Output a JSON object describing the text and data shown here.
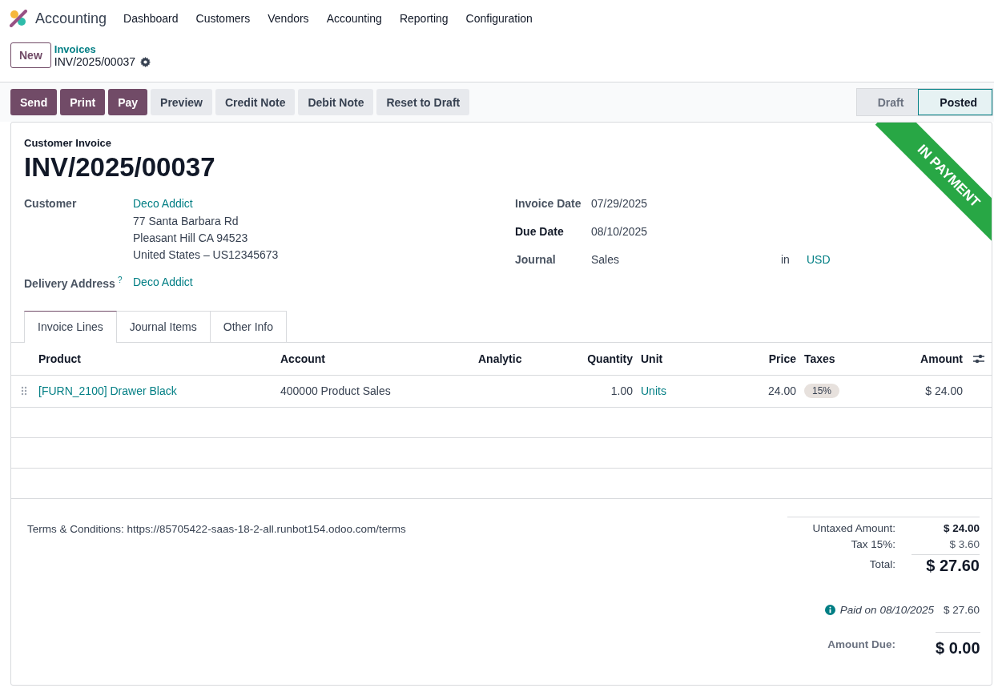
{
  "app": {
    "name": "Accounting"
  },
  "menu": [
    "Dashboard",
    "Customers",
    "Vendors",
    "Accounting",
    "Reporting",
    "Configuration"
  ],
  "new_button": "New",
  "breadcrumb": {
    "parent": "Invoices",
    "current": "INV/2025/00037"
  },
  "actions": [
    {
      "label": "Send",
      "kind": "primary"
    },
    {
      "label": "Print",
      "kind": "primary"
    },
    {
      "label": "Pay",
      "kind": "primary"
    },
    {
      "label": "Preview",
      "kind": "secondary"
    },
    {
      "label": "Credit Note",
      "kind": "secondary"
    },
    {
      "label": "Debit Note",
      "kind": "secondary"
    },
    {
      "label": "Reset to Draft",
      "kind": "secondary"
    }
  ],
  "status": [
    {
      "label": "Draft",
      "selected": false
    },
    {
      "label": "Posted",
      "selected": true
    }
  ],
  "ribbon": "IN PAYMENT",
  "document": {
    "type": "Customer Invoice",
    "number": "INV/2025/00037"
  },
  "customer": {
    "label": "Customer",
    "name": "Deco Addict",
    "address": [
      "77 Santa Barbara Rd",
      "Pleasant Hill CA 94523",
      "United States – US12345673"
    ]
  },
  "delivery": {
    "label": "Delivery Address",
    "help": "?",
    "value": "Deco Addict"
  },
  "right_fields": [
    {
      "label": "Invoice Date",
      "value": "07/29/2025",
      "required": false
    },
    {
      "label": "Due Date",
      "value": "08/10/2025",
      "required": true
    },
    {
      "label": "Journal",
      "value": "Sales",
      "required": false,
      "currency_prefix": "in",
      "currency": "USD"
    }
  ],
  "tabs": [
    {
      "label": "Invoice Lines",
      "selected": true
    },
    {
      "label": "Journal Items",
      "selected": false
    },
    {
      "label": "Other Info",
      "selected": false
    }
  ],
  "table": {
    "columns": [
      "Product",
      "Account",
      "Analytic",
      "Quantity",
      "Unit",
      "Price",
      "Taxes",
      "Amount"
    ],
    "rows": [
      {
        "product": "[FURN_2100] Drawer Black",
        "account": "400000 Product Sales",
        "quantity": "1.00",
        "unit": "Units",
        "price": "24.00",
        "taxes": [
          "15%"
        ],
        "amount": "$ 24.00"
      }
    ]
  },
  "terms": "Terms & Conditions: https://85705422-saas-18-2-all.runbot154.odoo.com/terms",
  "totals": [
    {
      "label": "Untaxed Amount:",
      "value": "$ 24.00",
      "kind": "untaxed"
    },
    {
      "label": "Tax 15%:",
      "value": "$ 3.60",
      "kind": "tax"
    },
    {
      "label": "Total:",
      "value": "$ 27.60",
      "kind": "total"
    }
  ],
  "payment": {
    "label": "Paid on 08/10/2025",
    "amount": "$ 27.60"
  },
  "amount_due": {
    "label": "Amount Due:",
    "value": "$ 0.00"
  }
}
